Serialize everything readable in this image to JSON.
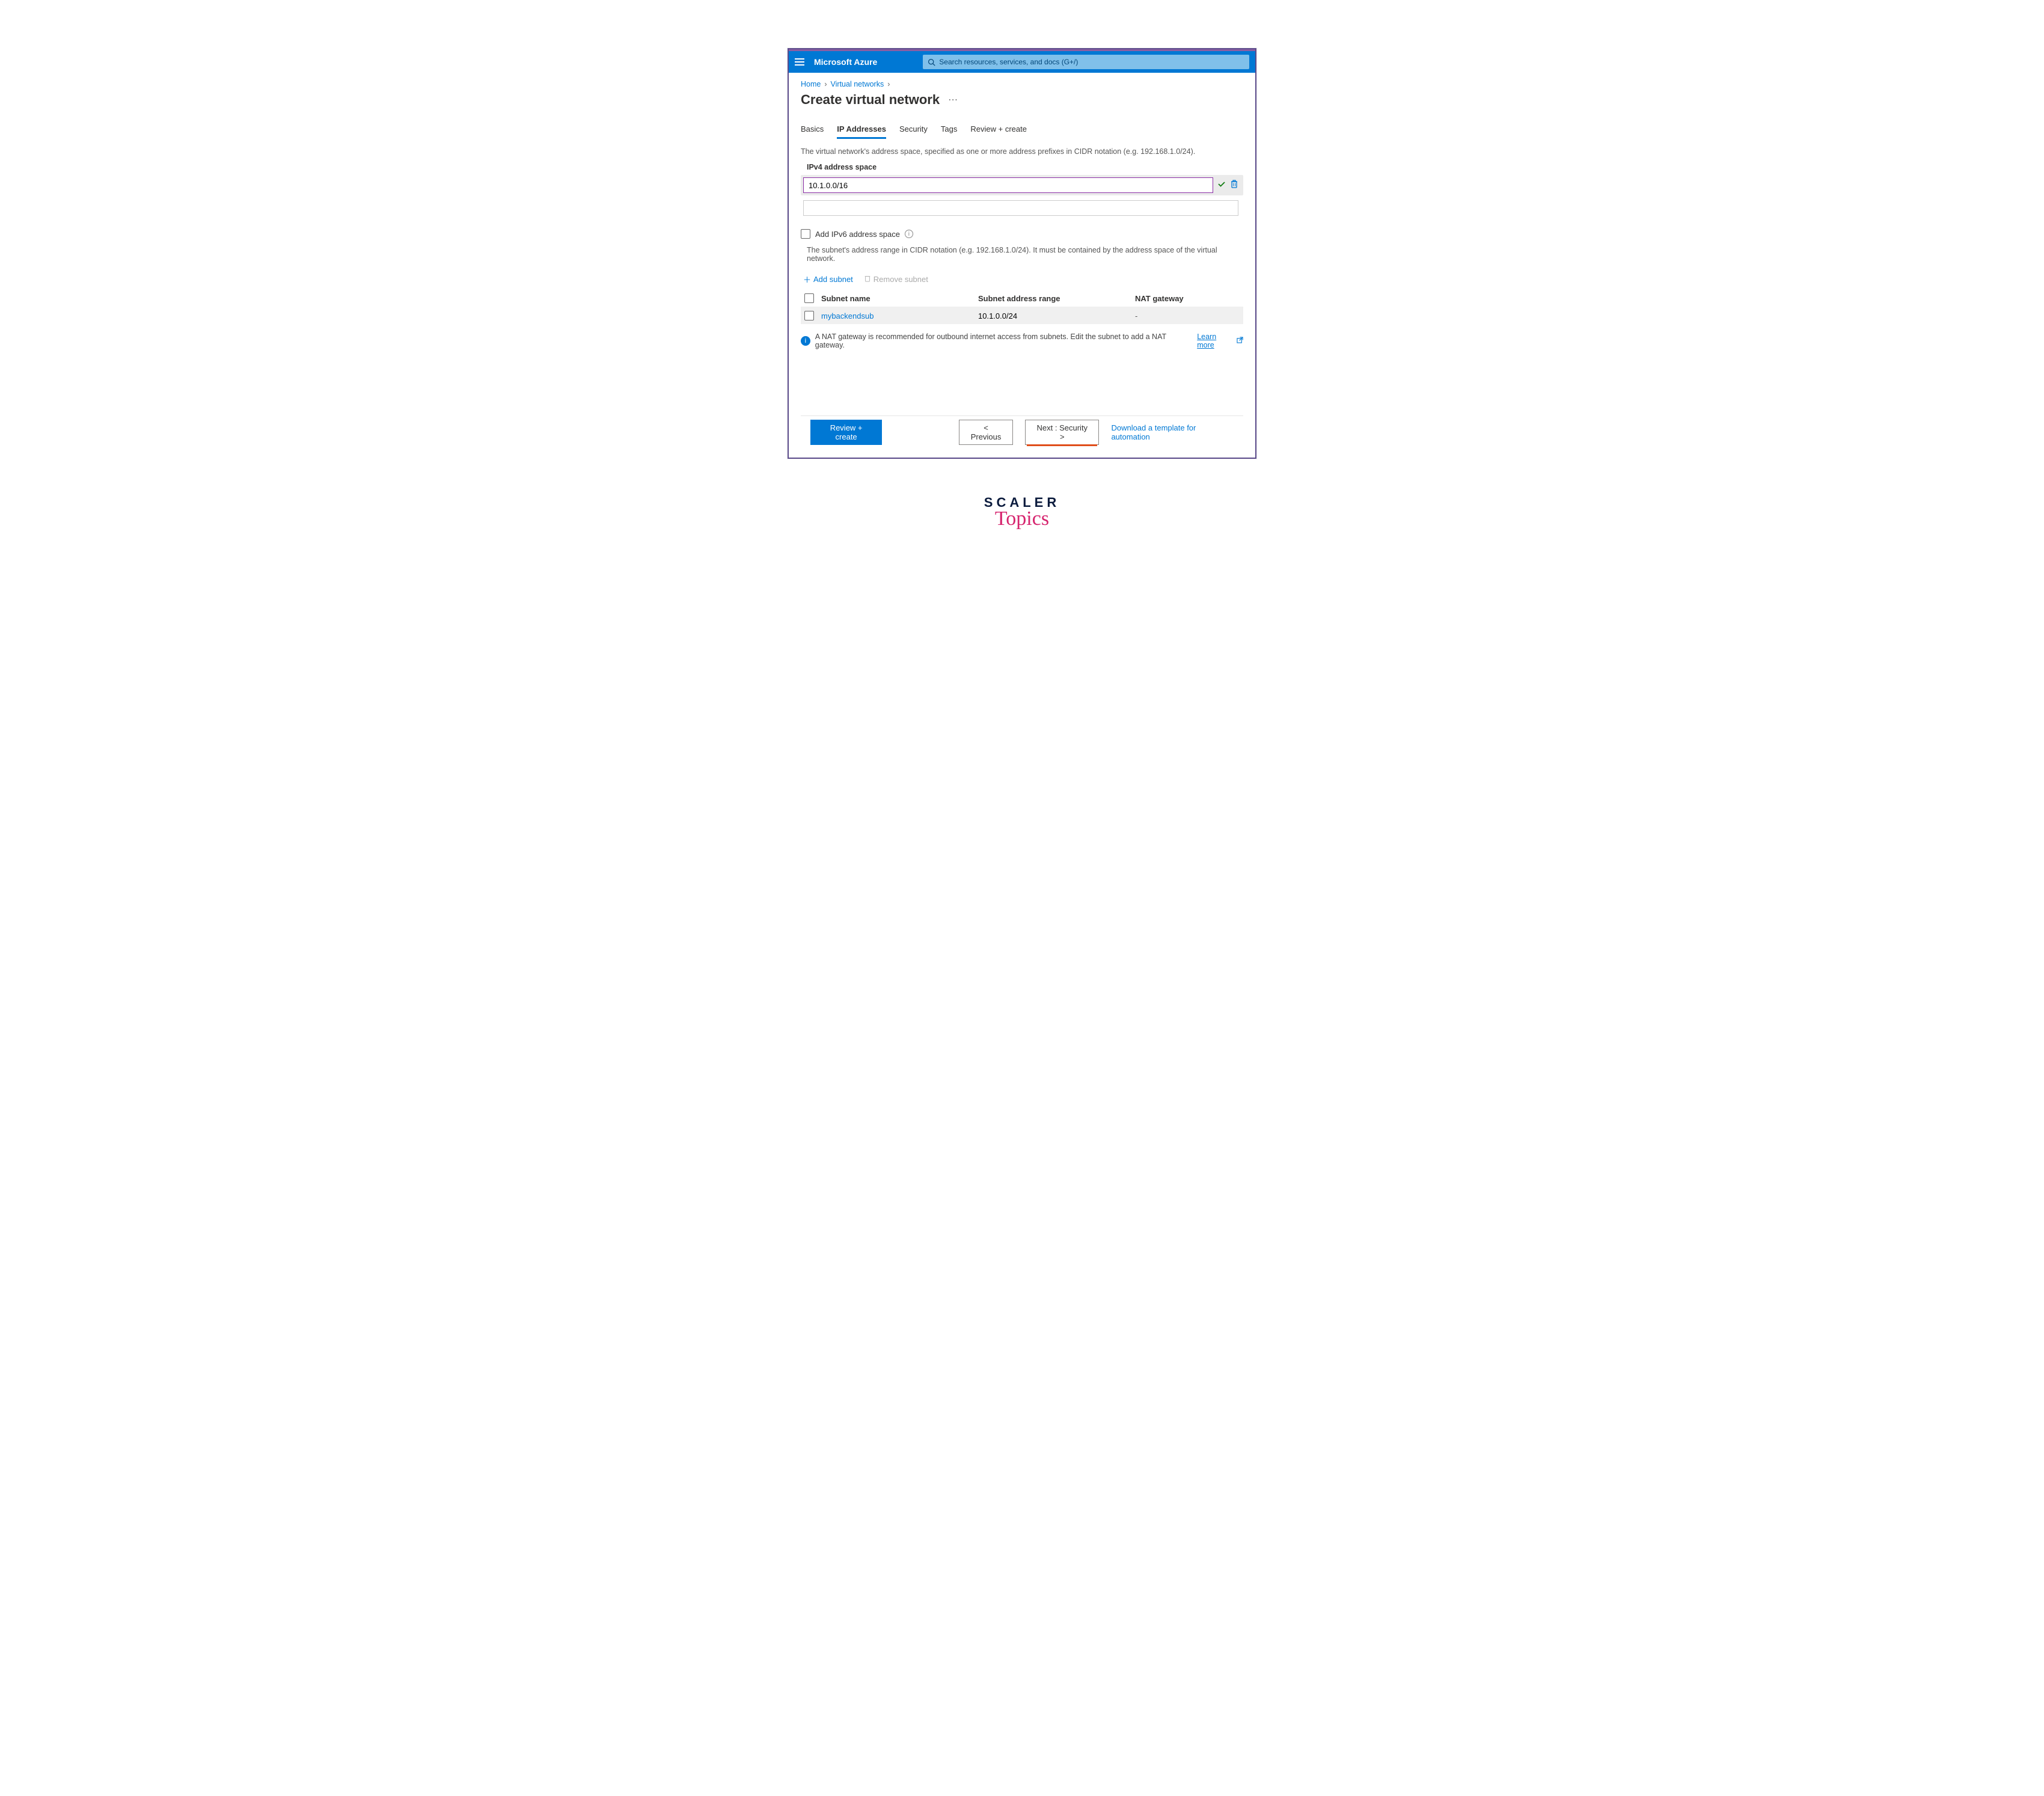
{
  "header": {
    "brand": "Microsoft Azure",
    "search_placeholder": "Search resources, services, and docs (G+/)"
  },
  "breadcrumb": {
    "home": "Home",
    "vnets": "Virtual networks"
  },
  "title": "Create virtual network",
  "tabs": {
    "basics": "Basics",
    "ip": "IP Addresses",
    "security": "Security",
    "tags": "Tags",
    "review": "Review + create"
  },
  "description": "The virtual network's address space, specified as one or more address prefixes in CIDR notation (e.g. 192.168.1.0/24).",
  "ipv4_label": "IPv4 address space",
  "ipv4_value": "10.1.0.0/16",
  "ipv6_label": "Add IPv6 address space",
  "subnet_desc": "The subnet's address range in CIDR notation (e.g. 192.168.1.0/24). It must be contained by the address space of the virtual network.",
  "actions": {
    "add_subnet": "Add subnet",
    "remove_subnet": "Remove subnet"
  },
  "table": {
    "col_name": "Subnet name",
    "col_range": "Subnet address range",
    "col_nat": "NAT gateway",
    "rows": [
      {
        "name": "mybackendsub",
        "range": "10.1.0.0/24",
        "nat": "-"
      }
    ]
  },
  "info_text": "A NAT gateway is recommended for outbound internet access from subnets. Edit the subnet to add a NAT gateway.",
  "learn_more": "Learn more",
  "footer": {
    "review": "Review + create",
    "previous": "< Previous",
    "next": "Next : Security >",
    "download": "Download a template for automation"
  },
  "watermark": {
    "line1": "SCALER",
    "line2": "Topics"
  }
}
